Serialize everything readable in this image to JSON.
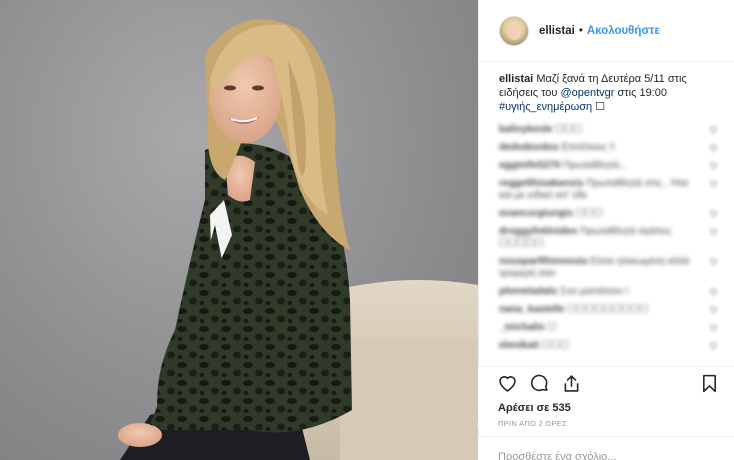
{
  "post": {
    "username": "ellistai",
    "follow_label": "Ακολουθήστε",
    "dot": "•",
    "caption": {
      "username": "ellistai",
      "text": "Μαζί ξανά τη Δευτέρα 5/11 στις ειδήσεις του",
      "mention": "@opentvgr",
      "text2": "στις 19:00",
      "hashtag": "#υγιής_ενημέρωση",
      "emoji": "☐"
    },
    "comments": [
      {
        "user": "kalinykesle",
        "text": "☐☐☐"
      },
      {
        "user": "dedodoodos",
        "text": "Επιτέλους !!"
      },
      {
        "user": "egginifo5270",
        "text": "Πρωταθλητά..."
      },
      {
        "user": "reggelthisakanxis",
        "text": "Πρωταθλητά στις , Ήτα και με ειδικό απ' έδε"
      },
      {
        "user": "evancurgiungis",
        "text": "☐☐☐"
      },
      {
        "user": "droggyfotiinides",
        "text": "Πρωταθλητά αγάπες ☐☐☐☐☐"
      },
      {
        "user": "nousparRhinnouiu",
        "text": "Είσαι ηλικιωμένη αλλά τρομερή σαν"
      },
      {
        "user": "pheneladalu",
        "text": "Σου ματιάσιου !"
      },
      {
        "user": "nana_kastelle",
        "text": "☐☐☐☐☐☐☐☐☐"
      },
      {
        "user": "_michalis",
        "text": "☐"
      },
      {
        "user": "elenikati",
        "text": "☐☐☐"
      }
    ],
    "likes_label": "Αρέσει σε 535",
    "time_ago": "ΠΡΙΝ ΑΠΟ 2 ΩΡΕΣ",
    "add_comment_placeholder": "Προσθέστε ένα σχόλιο..."
  },
  "icons": {
    "like": "heart-icon",
    "comment": "comment-icon",
    "share": "share-icon",
    "save": "bookmark-icon"
  },
  "colors": {
    "link": "#003569",
    "follow": "#3897f0",
    "text": "#262626",
    "muted": "#999999"
  }
}
